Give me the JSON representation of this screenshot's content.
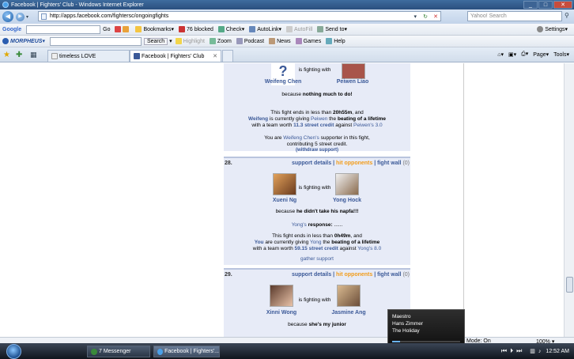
{
  "window": {
    "title": "Facebook | Fighters' Club - Windows Internet Explorer"
  },
  "address": {
    "url": "http://apps.facebook.com/fightersc/ongoingfights",
    "search_placeholder": "Yahoo! Search"
  },
  "google_bar": {
    "logo": "Google",
    "search_btn": "Go",
    "bookmarks": "Bookmarks",
    "blocked": "76 blocked",
    "check": "Check",
    "autolink": "AutoLink",
    "autofill": "AutoFill",
    "send_to": "Send to",
    "settings": "Settings"
  },
  "morpheus_bar": {
    "logo": "MORPHEUS",
    "search_btn": "Search",
    "highlight": "Highlight",
    "zoom": "Zoom",
    "podcast": "Podcast",
    "news": "News",
    "games": "Games",
    "help": "Help"
  },
  "tabs": [
    {
      "label": "timeless LOVE"
    },
    {
      "label": "Facebook | Fighters' Club"
    }
  ],
  "command_bar": {
    "page": "Page",
    "tools": "Tools"
  },
  "top_entry": {
    "left_name": "Weifeng Chen",
    "right_name": "Peiwen Liao",
    "fighting": "is fighting with",
    "because": "because",
    "reason": "nothing much to do!",
    "ends_prefix": "This fight ends in less than",
    "ends_time": "20h55m",
    "ends_suffix": ", and",
    "giver": "Weifeng",
    "giving": "is currently giving",
    "receiver": "Peiwen",
    "the": "the",
    "beating": "beating of a lifetime",
    "team_prefix": "with a team worth",
    "credit": "11.3 street credit",
    "against": "against",
    "against_who": "Peiwen's 3.0",
    "supporter_prefix": "You are",
    "supporter_name": "Weifeng Chen's",
    "supporter_suffix": "supporter in this fight,",
    "contributing": "contributing 5 street credit.",
    "withdraw": "(withdraw support)"
  },
  "entry28": {
    "num": "28.",
    "support": "support details",
    "hit": "hit opponents",
    "wall": "fight wall",
    "wall_count": "(0)",
    "left_name": "Xueni Ng",
    "right_name": "Yong Hock",
    "fighting": "is fighting with",
    "because": "because",
    "reason": "he didn't take his napfa!!!",
    "resp_who": "Yong's",
    "resp_label": "response:",
    "resp_text": "......",
    "ends_prefix": "This fight ends in less than",
    "ends_time": "0h49m",
    "ends_suffix": ", and",
    "giver": "You",
    "giving": "are currently giving",
    "receiver": "Yong",
    "the": "the",
    "beating": "beating of a lifetime",
    "team_prefix": "with a team worth",
    "credit": "59.15 street credit",
    "against": "against",
    "against_who": "Yong's 8.0",
    "gather": "gather support"
  },
  "entry29": {
    "num": "29.",
    "support": "support details",
    "hit": "hit opponents",
    "wall": "fight wall",
    "wall_count": "(0)",
    "left_name": "Xinni Wong",
    "right_name": "Jasmine Ang",
    "fighting": "is fighting with",
    "because": "because",
    "reason": "she's my junior"
  },
  "media_popup": {
    "artist": "Maestro",
    "composer": "Hans Zimmer",
    "track": "The Holiday"
  },
  "status": {
    "mode": "Mode: On",
    "zoom": "100%"
  },
  "taskbar": {
    "task1": "7 Messenger",
    "task2": "Facebook | Fighters'...",
    "clock": "12:52 AM"
  },
  "colors": {
    "fb_blue": "#3b5998",
    "orange_link": "#f29c1a",
    "panel_bg": "#e7ebf7"
  }
}
